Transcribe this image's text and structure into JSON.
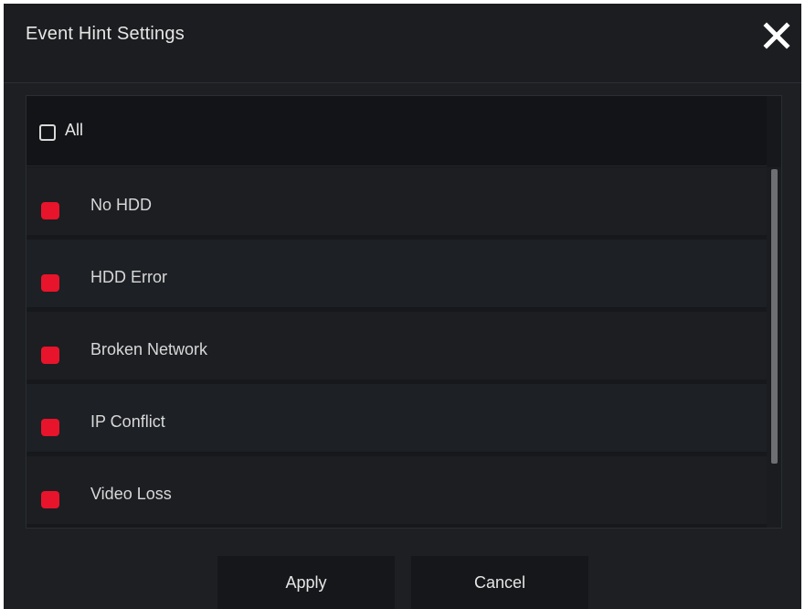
{
  "dialog": {
    "title": "Event Hint Settings",
    "close_icon": "close-icon"
  },
  "all_option": {
    "label": "All",
    "checked": false
  },
  "events": [
    {
      "label": "No HDD",
      "checked": true
    },
    {
      "label": "HDD Error",
      "checked": true
    },
    {
      "label": "Broken Network",
      "checked": true
    },
    {
      "label": "IP Conflict",
      "checked": true
    },
    {
      "label": "Video Loss",
      "checked": true
    }
  ],
  "buttons": {
    "apply": "Apply",
    "cancel": "Cancel"
  },
  "colors": {
    "checked_accent": "#e8142b",
    "background": "#1d1f23"
  }
}
